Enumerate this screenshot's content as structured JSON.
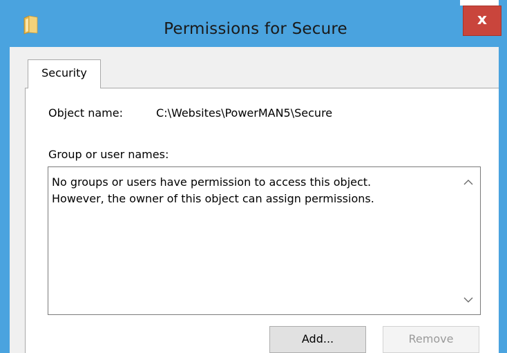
{
  "window": {
    "title": "Permissions for Secure",
    "close_label": "x",
    "icon": "folder-icon",
    "accent_color": "#4aa3df",
    "close_color": "#c9453c"
  },
  "tabs": [
    {
      "label": "Security",
      "selected": true
    }
  ],
  "object": {
    "label": "Object name:",
    "value": "C:\\Websites\\PowerMAN5\\Secure"
  },
  "names": {
    "label": "Group or user names:",
    "message_line1": "No groups or users have permission to access this object.",
    "message_line2": "However, the owner of this object can assign permissions.",
    "scroll_up_icon": "chevron-up-icon",
    "scroll_down_icon": "chevron-down-icon"
  },
  "buttons": {
    "add_label": "Add...",
    "remove_label": "Remove",
    "remove_enabled": false
  }
}
